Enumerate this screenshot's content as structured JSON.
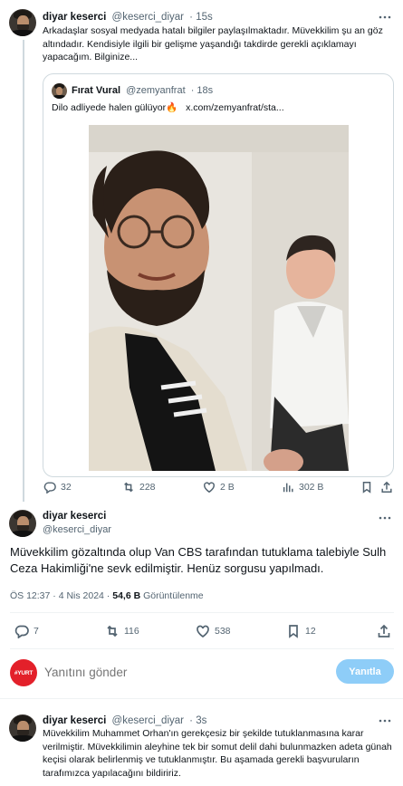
{
  "colors": {
    "accent": "#1d9bf0",
    "reply_button_disabled": "#8ecdf8",
    "muted_text": "#536471",
    "border": "#cfd9de",
    "yurt_red": "#e3202a"
  },
  "tweet1": {
    "author_name": "diyar keserci",
    "author_handle": "@keserci_diyar",
    "age": "· 15s",
    "text": "Arkadaşlar sosyal medyada hatalı bilgiler paylaşılmaktadır.   Müvekkilim şu an göz altındadır. Kendisiyle ilgili bir gelişme yaşandığı takdirde gerekli açıklamayı yapacağım. Bilginize...",
    "quote": {
      "author_name": "Fırat Vural",
      "author_handle": "@zemyanfrat",
      "age": "· 18s",
      "text": "Dilo adliyede halen gülüyor",
      "emoji": "🔥",
      "link": "x.com/zemyanfrat/sta..."
    },
    "stats": {
      "replies": "32",
      "reposts": "228",
      "likes": "2 B",
      "views": "302 B"
    }
  },
  "tweet2": {
    "author_name": "diyar keserci",
    "author_handle": "@keserci_diyar",
    "text": "Müvekkilim gözaltında olup Van CBS tarafından tutuklama  talebiyle Sulh Ceza Hakimliği'ne sevk edilmiştir. Henüz sorgusu yapılmadı.",
    "time": "ÖS 12:37 · 4 Nis 2024 · ",
    "views_count": "54,6 B",
    "views_label": " Görüntülenme",
    "stats": {
      "replies": "7",
      "reposts": "116",
      "likes": "538",
      "bookmarks": "12"
    }
  },
  "compose": {
    "avatar_text": "#YURT",
    "placeholder": "Yanıtını gönder",
    "button_label": "Yanıtla"
  },
  "tweet3": {
    "author_name": "diyar keserci",
    "author_handle": "@keserci_diyar",
    "age": "· 3s",
    "text": "Müvekkilim Muhammet Orhan'ın gerekçesiz bir şekilde tutuklanmasına karar verilmiştir. Müvekkilimin aleyhine tek bir somut delil dahi bulunmazken adeta günah keçisi olarak belirlenmiş ve tutuklanmıştır. Bu aşamada gerekli başvuruların tarafımızca yapılacağını bildiririz."
  }
}
